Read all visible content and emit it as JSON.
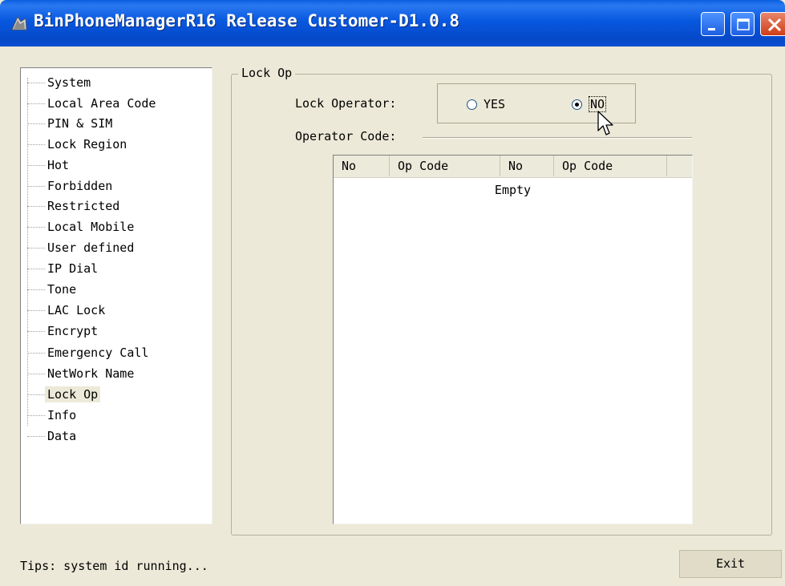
{
  "window": {
    "title": "BinPhoneManagerR16 Release Customer-D1.0.8"
  },
  "tree": {
    "items": [
      {
        "label": "System"
      },
      {
        "label": "Local Area Code"
      },
      {
        "label": "PIN & SIM"
      },
      {
        "label": "Lock Region"
      },
      {
        "label": "Hot"
      },
      {
        "label": "Forbidden"
      },
      {
        "label": "Restricted"
      },
      {
        "label": "Local Mobile"
      },
      {
        "label": "User defined"
      },
      {
        "label": "IP Dial"
      },
      {
        "label": "Tone"
      },
      {
        "label": "LAC Lock"
      },
      {
        "label": "Encrypt"
      },
      {
        "label": "Emergency Call"
      },
      {
        "label": "NetWork Name"
      },
      {
        "label": "Lock Op"
      },
      {
        "label": "Info"
      },
      {
        "label": "Data"
      }
    ],
    "selected": "Lock Op"
  },
  "panel": {
    "group_title": "Lock Op",
    "lock_operator_label": "Lock Operator:",
    "radio_yes": "YES",
    "radio_no": "NO",
    "selected_option": "NO",
    "operator_code_label": "Operator Code:",
    "columns": [
      "No",
      "Op Code",
      "No",
      "Op Code"
    ],
    "empty_text": "Empty"
  },
  "status": {
    "tips": "Tips: system id running..."
  },
  "buttons": {
    "exit": "Exit"
  },
  "colors": {
    "titlebar": "#0858e0",
    "window_bg": "#ece9d8",
    "close_button": "#cf3d17"
  }
}
